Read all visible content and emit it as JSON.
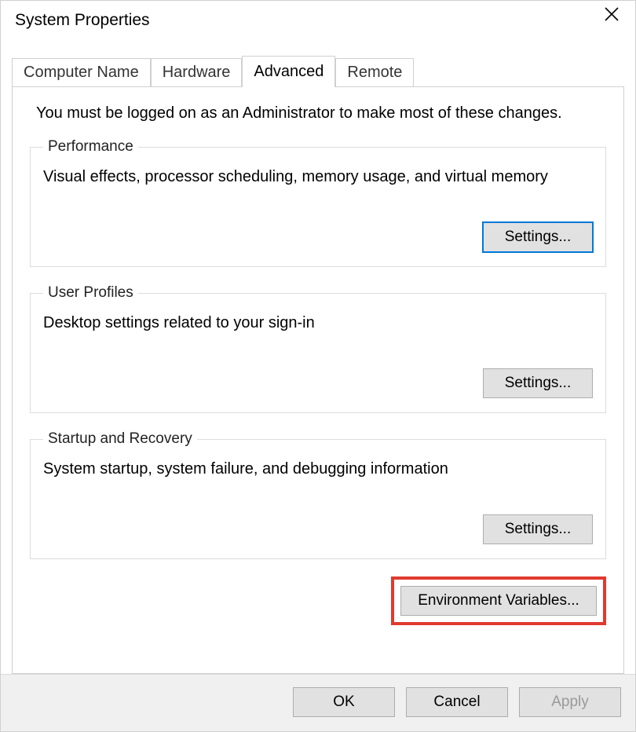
{
  "window": {
    "title": "System Properties"
  },
  "tabs": {
    "computer_name": "Computer Name",
    "hardware": "Hardware",
    "advanced": "Advanced",
    "remote": "Remote"
  },
  "advanced_panel": {
    "intro": "You must be logged on as an Administrator to make most of these changes.",
    "performance": {
      "legend": "Performance",
      "desc": "Visual effects, processor scheduling, memory usage, and virtual memory",
      "settings_label": "Settings..."
    },
    "user_profiles": {
      "legend": "User Profiles",
      "desc": "Desktop settings related to your sign-in",
      "settings_label": "Settings..."
    },
    "startup_recovery": {
      "legend": "Startup and Recovery",
      "desc": "System startup, system failure, and debugging information",
      "settings_label": "Settings..."
    },
    "env_vars_label": "Environment Variables..."
  },
  "buttons": {
    "ok": "OK",
    "cancel": "Cancel",
    "apply": "Apply"
  }
}
